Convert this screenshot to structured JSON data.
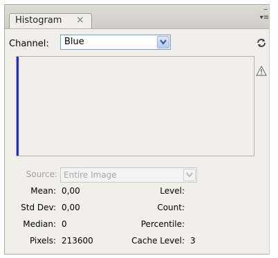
{
  "tab": {
    "title": "Histogram",
    "close": "×"
  },
  "window": {
    "minimize": "–",
    "panel_menu": "▾≡"
  },
  "channel": {
    "label": "Channel:",
    "value": "Blue"
  },
  "source": {
    "label": "Source:",
    "value": "Entire Image"
  },
  "stats": {
    "mean_label": "Mean:",
    "mean_value": "0,00",
    "stddev_label": "Std Dev:",
    "stddev_value": "0,00",
    "median_label": "Median:",
    "median_value": "0",
    "pixels_label": "Pixels:",
    "pixels_value": "213600",
    "level_label": "Level:",
    "level_value": "",
    "count_label": "Count:",
    "count_value": "",
    "percentile_label": "Percentile:",
    "percentile_value": "",
    "cache_label": "Cache Level:",
    "cache_value": "3"
  },
  "colors": {
    "channel_line": "#1f2bd6",
    "panel_bg": "#f0efeb"
  },
  "icons": {
    "refresh": "refresh-icon",
    "warning": "warning-icon",
    "dropdown": "chevron-down-icon"
  }
}
